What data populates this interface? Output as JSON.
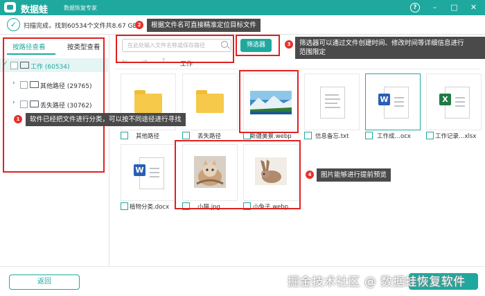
{
  "app": {
    "name": "数据蛙",
    "subtitle": "数据恢复专家"
  },
  "window_controls": {
    "help": "?",
    "minimize": "–",
    "maximize": "□",
    "close": "✕"
  },
  "status": {
    "text": "扫描完成，找到60534个文件共8.67 GB。"
  },
  "tabs": {
    "by_path": "按路径查看",
    "by_type": "按类型查看"
  },
  "tree": [
    {
      "label": "工作 (60534)",
      "chevron": "✓"
    },
    {
      "label": "其他路径 (29765)",
      "chevron": "›"
    },
    {
      "label": "丢失路径 (30762)",
      "chevron": "›"
    }
  ],
  "search": {
    "placeholder": "在此处输入文件名称或保存路径"
  },
  "filter_button": "筛选器",
  "nav": {
    "back": "←",
    "forward": "→",
    "up": "↑"
  },
  "path_label": "工作",
  "files": [
    {
      "name": "其他路径",
      "kind": "folder"
    },
    {
      "name": "丢失路径",
      "kind": "folder"
    },
    {
      "name": "新疆美景.webp",
      "kind": "image-landscape"
    },
    {
      "name": "信息备忘.txt",
      "kind": "text"
    },
    {
      "name": "工作成…ocx",
      "kind": "word"
    },
    {
      "name": "工作记录…xlsx",
      "kind": "excel"
    },
    {
      "name": "植物分类.docx",
      "kind": "word"
    },
    {
      "name": "小猫.jpg",
      "kind": "image-cat"
    },
    {
      "name": "小兔子.webp",
      "kind": "image-rabbit"
    }
  ],
  "annotations": [
    {
      "num": "1",
      "text": "软件已经把文件进行分类，可以按不同途径进行寻找"
    },
    {
      "num": "2",
      "text": "根据文件名可直接精准定位目标文件"
    },
    {
      "num": "3",
      "text_line1": "筛选器可以通过文件创建时间、修改时间等详细信息进行",
      "text_line2": "范围限定"
    },
    {
      "num": "4",
      "text": "图片能够进行提前预览"
    }
  ],
  "back_button": "返回",
  "watermark": "掘金技术社区 @ 数据蛙恢复软件",
  "colors": {
    "accent": "#1fa89e",
    "highlight": "#e02020",
    "note_bg": "#4a4a4a"
  },
  "icons": {
    "word": "W",
    "excel": "X"
  }
}
